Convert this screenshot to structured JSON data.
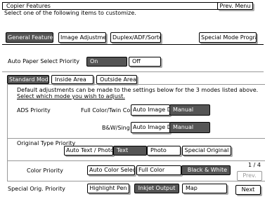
{
  "header": {
    "title": "Copier Features",
    "subtitle": "Select one of the following items to customize.",
    "prev_menu": "Prev. Menu"
  },
  "tabs": [
    {
      "label": "General Features",
      "selected": true
    },
    {
      "label": "Image Adjustment",
      "selected": false
    },
    {
      "label": "Duplex/ADF/Sorter",
      "selected": false
    },
    {
      "label": "Special Mode Program(s)",
      "selected": false
    }
  ],
  "auto_paper": {
    "label": "Auto Paper Select Priority",
    "on": "On",
    "off": "Off",
    "selected": "On"
  },
  "mode_tabs": {
    "standard": "Standard Mode",
    "inside": "Inside Area",
    "outside": "Outside Area",
    "selected": "Standard Mode"
  },
  "description": {
    "line1": "Default adjustments can be made to the settings below for the 3 modes listed above.",
    "line2": "Select which mode you wish to adjust."
  },
  "ads": {
    "label": "ADS Priority",
    "row1_label": "Full Color/Twin Color",
    "row1_auto": "Auto Image Density",
    "row1_manual": "Manual",
    "row2_label": "B&W/Single",
    "row2_auto": "Auto Image Density",
    "row2_manual": "Manual"
  },
  "original_type": {
    "label": "Original Type Priority",
    "options": [
      "Auto Text / Photo",
      "Text",
      "Photo",
      "Special Original"
    ],
    "selected": "Text"
  },
  "color_priority": {
    "label": "Color Priority",
    "options": [
      "Auto Color Select",
      "Full Color",
      "Black & White"
    ],
    "selected": "Black & White"
  },
  "special_orig": {
    "label": "Special Orig. Priority",
    "options": [
      "Highlight Pen",
      "Inkjet Output",
      "Map"
    ],
    "selected": "Inkjet Output"
  },
  "pager": {
    "page": "1 / 4",
    "prev": "Prev.",
    "next": "Next"
  },
  "colors": {
    "selected_bg": "#555555",
    "frame": "#999999"
  }
}
